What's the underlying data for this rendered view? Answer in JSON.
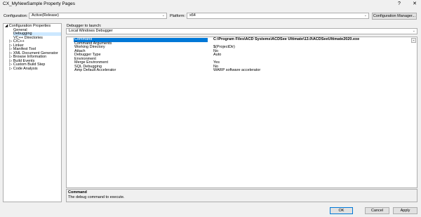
{
  "window": {
    "title": "CX_MyNewSample Property Pages",
    "help_label": "?",
    "close_label": "✕"
  },
  "toolbar": {
    "configuration_label": "Configuration:",
    "configuration_value": "Active(Release)",
    "platform_label": "Platform:",
    "platform_value": "x64",
    "config_manager_label": "Configuration Manager..."
  },
  "tree": {
    "items": [
      {
        "label": "Configuration Properties",
        "glyph": "◢"
      },
      {
        "label": "General"
      },
      {
        "label": "Debugging"
      },
      {
        "label": "VC++ Directories"
      },
      {
        "label": "C/C++",
        "glyph": "▷"
      },
      {
        "label": "Linker",
        "glyph": "▷"
      },
      {
        "label": "Manifest Tool",
        "glyph": "▷"
      },
      {
        "label": "XML Document Generator",
        "glyph": "▷"
      },
      {
        "label": "Browse Information",
        "glyph": "▷"
      },
      {
        "label": "Build Events",
        "glyph": "▷"
      },
      {
        "label": "Custom Build Step",
        "glyph": "▷"
      },
      {
        "label": "Code Analysis",
        "glyph": "▷"
      }
    ]
  },
  "debugger": {
    "launch_label": "Debugger to launch:",
    "launch_value": "Local Windows Debugger"
  },
  "properties": [
    {
      "name": "Command",
      "value": "C:\\Program Files\\ACD Systems\\ACDSee Ultimate\\13.0\\ACDSeeUltimate2020.exe"
    },
    {
      "name": "Command Arguments",
      "value": ""
    },
    {
      "name": "Working Directory",
      "value": "$(ProjectDir)"
    },
    {
      "name": "Attach",
      "value": "No"
    },
    {
      "name": "Debugger Type",
      "value": "Auto"
    },
    {
      "name": "Environment",
      "value": ""
    },
    {
      "name": "Merge Environment",
      "value": "Yes"
    },
    {
      "name": "SQL Debugging",
      "value": "No"
    },
    {
      "name": "Amp Default Accelerator",
      "value": "WARP software accelerator"
    }
  ],
  "description": {
    "title": "Command",
    "text": "The debug command to execute."
  },
  "footer": {
    "ok_label": "OK",
    "cancel_label": "Cancel",
    "apply_label": "Apply"
  },
  "icons": {
    "expanded": "triangle-down-icon",
    "collapsed": "triangle-right-icon",
    "dropdown": "chevron-down-icon"
  }
}
